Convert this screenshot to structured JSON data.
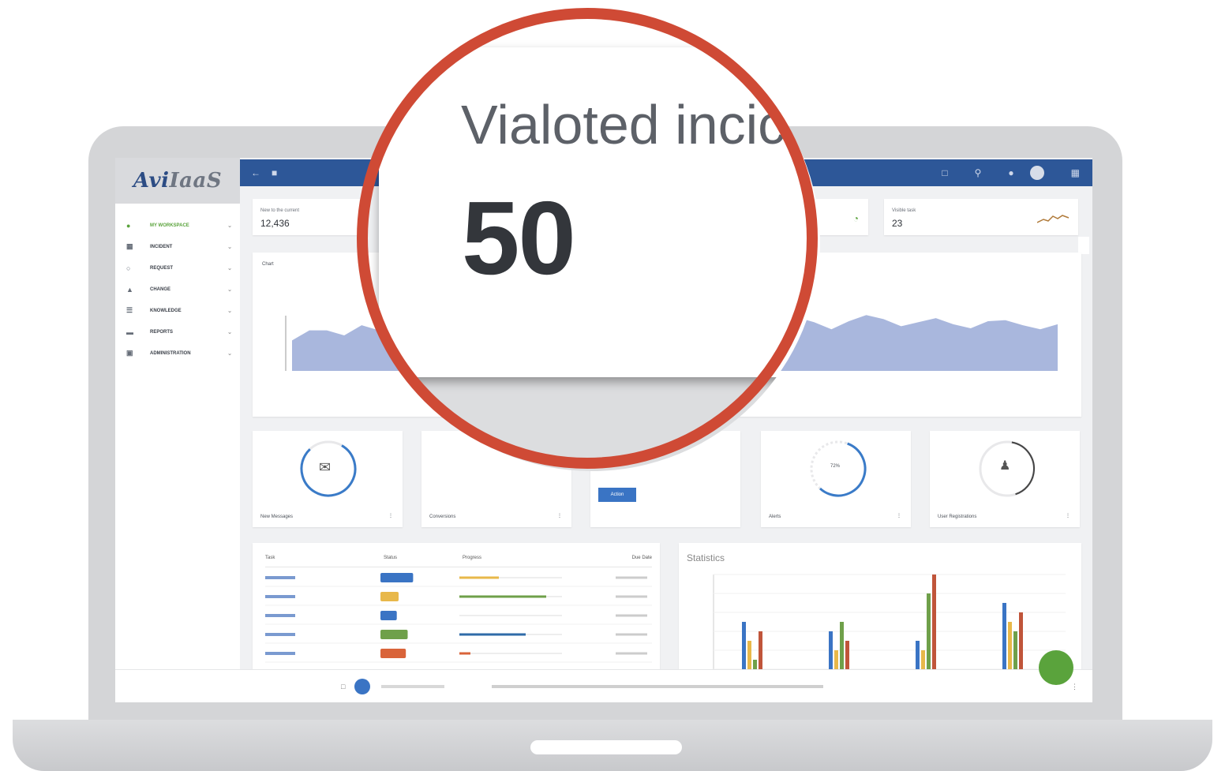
{
  "app": {
    "logo_main": "Avi",
    "logo_suffix": "IaaS"
  },
  "magnifier": {
    "title": "Vialoted incic",
    "value": "50"
  },
  "sidebar": {
    "items": [
      {
        "icon": "globe-icon",
        "label": "MY WORKSPACE",
        "active": true
      },
      {
        "icon": "grid-icon",
        "label": "INCIDENT"
      },
      {
        "icon": "chat-icon",
        "label": "REQUEST"
      },
      {
        "icon": "users-icon",
        "label": "CHANGE"
      },
      {
        "icon": "list-icon",
        "label": "KNOWLEDGE"
      },
      {
        "icon": "folder-icon",
        "label": "REPORTS"
      },
      {
        "icon": "doc-icon",
        "label": "ADMINISTRATION"
      }
    ]
  },
  "stats": [
    {
      "label": "New to the current",
      "value": "12,436"
    },
    {
      "label": "Visible task",
      "value": "23"
    }
  ],
  "chart_card": {
    "title": "Chart"
  },
  "widgets": [
    {
      "label": "New Messages",
      "icon": "mail-icon"
    },
    {
      "label": "Conversions"
    },
    {
      "label": "",
      "button": "Action"
    },
    {
      "label": "Alerts",
      "center": "72%"
    },
    {
      "label": "User Registrations",
      "icon": "user-add-icon"
    }
  ],
  "table": {
    "columns": [
      "Task",
      "Status",
      "Progress",
      "Due Date"
    ]
  },
  "stats_chart": {
    "title": "Statistics"
  },
  "colors": {
    "brand_blue": "#2d5798",
    "accent_red": "#cf4a35",
    "green": "#5aa33c",
    "area_fill": "#a9b7dd"
  },
  "chart_data": [
    {
      "type": "area",
      "title": "Chart",
      "series": [
        {
          "values": [
            3,
            4,
            4,
            3.5,
            4.5,
            4,
            5,
            4.2,
            4.8,
            4,
            4.6,
            3.8,
            4.3,
            5,
            4.1,
            4.7,
            4.9,
            4.4,
            5.2,
            4.6,
            4,
            4.8,
            5.4,
            4.9,
            4.2,
            5.1,
            5.6,
            5.0,
            4.6,
            5.3,
            4.8,
            4.1,
            4.9,
            5.5,
            5.1,
            4.4,
            4.8,
            5.2,
            4.6,
            4.2,
            4.9,
            5.0,
            4.5,
            4.1,
            4.6
          ]
        }
      ]
    },
    {
      "type": "bar",
      "title": "Statistics",
      "categories": [
        "",
        "",
        "",
        ""
      ],
      "series": [
        {
          "values": [
            5,
            4,
            3,
            7
          ]
        },
        {
          "values": [
            3,
            2,
            2,
            5
          ]
        },
        {
          "values": [
            1,
            5,
            8,
            4
          ]
        },
        {
          "values": [
            4,
            3,
            10,
            6
          ]
        }
      ]
    }
  ]
}
